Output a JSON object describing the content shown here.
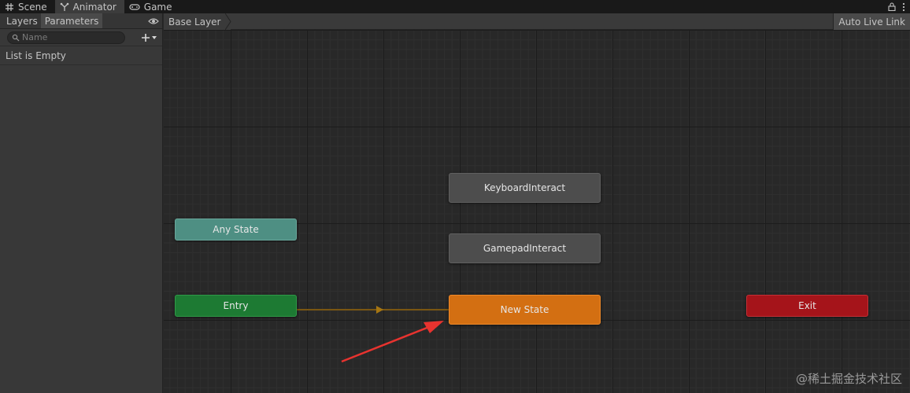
{
  "window": {
    "tabs": [
      {
        "label": "Scene",
        "icon": "grid-icon"
      },
      {
        "label": "Animator",
        "icon": "animator-icon"
      },
      {
        "label": "Game",
        "icon": "gamepad-icon"
      }
    ],
    "active_tab": "Animator"
  },
  "left_panel": {
    "tabs": [
      {
        "label": "Layers"
      },
      {
        "label": "Parameters"
      }
    ],
    "active_tab": "Parameters",
    "search": {
      "placeholder": "Name",
      "value": ""
    },
    "empty_message": "List is Empty"
  },
  "graph": {
    "breadcrumb": "Base Layer",
    "auto_live_link": "Auto Live Link",
    "states": {
      "any_state": "Any State",
      "entry": "Entry",
      "exit": "Exit",
      "keyboard": "KeyboardInteract",
      "gamepad": "GamepadInteract",
      "new_state": "New State"
    }
  },
  "colors": {
    "any_state": "#4e8f83",
    "entry": "#1d7a33",
    "exit": "#a5141a",
    "default_state": "#d36f12",
    "state": "#4d4d4d",
    "transition": "#7a5612",
    "annotation_arrow": "#e8332f"
  },
  "watermark": "@稀土掘金技术社区"
}
